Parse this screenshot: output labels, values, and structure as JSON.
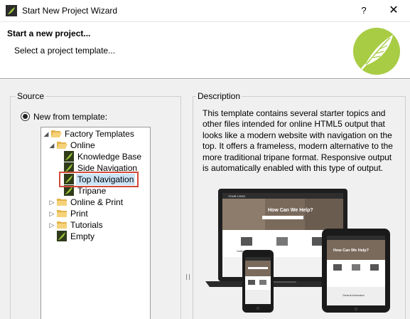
{
  "window": {
    "title": "Start New Project Wizard",
    "help_label": "?",
    "close_label": "✕"
  },
  "header": {
    "title": "Start a new project...",
    "subtitle": "Select a project template..."
  },
  "source": {
    "legend": "Source",
    "radio_label": "New from template:",
    "tree": {
      "factory": "Factory Templates",
      "online": "Online",
      "knowledge_base": "Knowledge Base",
      "side_navigation": "Side Navigation",
      "top_navigation": "Top Navigation",
      "tripane": "Tripane",
      "online_print": "Online & Print",
      "print": "Print",
      "tutorials": "Tutorials",
      "empty": "Empty"
    }
  },
  "description": {
    "legend": "Description",
    "text": "This template contains several starter topics and other files intended for online HTML5 output that looks like a modern website with navigation on the top. It offers a frameless, modern alternative to the more traditional tripane format. Responsive output is automatically enabled with this type of output.",
    "preview": {
      "logo_text": "YOUR LOGO",
      "hero_text": "How Can We Help?",
      "tile_caption": "Getting Started",
      "section_caption": "General Information"
    }
  },
  "colors": {
    "accent": "#9bc43a",
    "selection": "#cce4f7",
    "highlight_box": "#d04a3a",
    "panel": "#f0f0f0"
  }
}
